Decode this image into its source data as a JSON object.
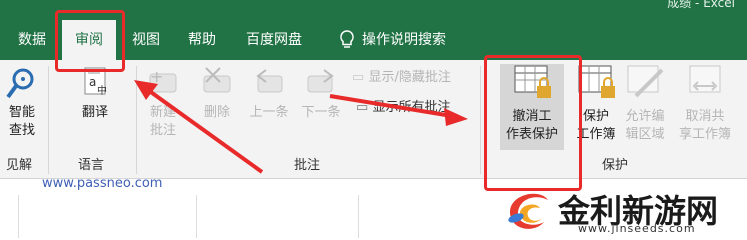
{
  "window": {
    "title": "Excel",
    "doc_name": "成绩"
  },
  "tabs": [
    {
      "label": "数据"
    },
    {
      "label": "审阅"
    },
    {
      "label": "视图"
    },
    {
      "label": "帮助"
    },
    {
      "label": "百度网盘"
    }
  ],
  "tell_me": {
    "label": "操作说明搜索",
    "icon": "lightbulb-icon"
  },
  "ribbon": {
    "smart_lookup": {
      "label1": "智能",
      "label2": "查找"
    },
    "insights_group": "见解",
    "translate": {
      "label": "翻译"
    },
    "language_group": "语言",
    "new_comment": {
      "label1": "新建",
      "label2": "批注"
    },
    "delete": {
      "label": "删除"
    },
    "previous": {
      "label": "上一条"
    },
    "next": {
      "label": "下一条"
    },
    "show_hide": {
      "label": "显示/隐藏批注"
    },
    "show_all": {
      "label": "显示所有批注"
    },
    "comments_group": "批注",
    "unprotect_sheet": {
      "label1": "撤消工",
      "label2": "作表保护"
    },
    "protect_workbook": {
      "label1": "保护",
      "label2": "工作簿"
    },
    "allow_edit": {
      "label1": "允许编",
      "label2": "辑区域"
    },
    "unshare": {
      "label1": "取消共",
      "label2": "享工作簿"
    },
    "protect_group": "保护"
  },
  "watermark": "www.passneo.com",
  "logo": {
    "text": "金利新游网",
    "url": "www.jlnseeds.com"
  },
  "colors": {
    "excel_green": "#217346",
    "annotation_red": "#e82a2a"
  }
}
